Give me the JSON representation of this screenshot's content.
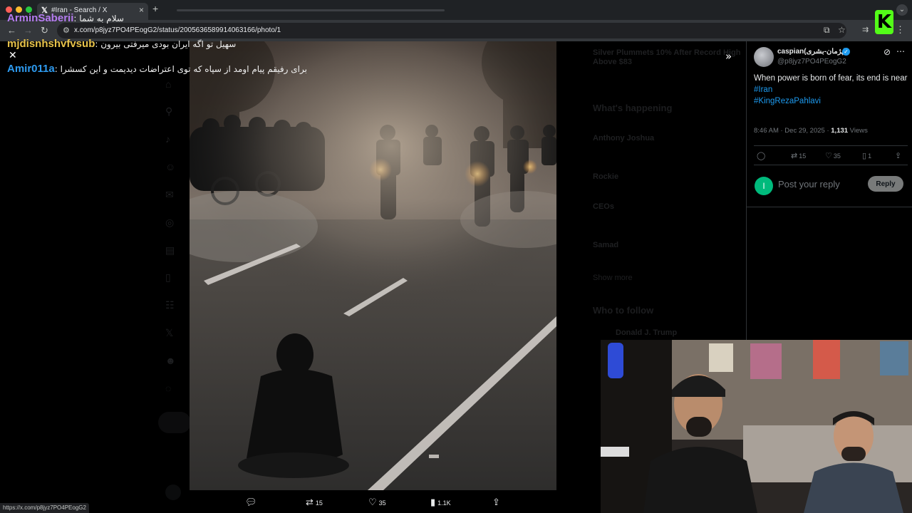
{
  "browser": {
    "tab_title": "#Iran - Search / X",
    "tab_close": "×",
    "new_tab": "+",
    "tab_menu": "⌄",
    "url": "x.com/p8jyz7PO4PEogG2/status/2005636589914063166/photo/1",
    "status_url": "https://x.com/p8jyz7PO4PEogG2",
    "icons": [
      "back-icon",
      "forward-icon",
      "reload-icon",
      "site-info-icon",
      "cast-icon",
      "bookmark-star-icon",
      "extensions-icon",
      "kick-extension-icon",
      "menu-icon"
    ],
    "kick_logo": "K"
  },
  "chat": [
    {
      "user": "ArminSaberii",
      "message": "سلام به شما",
      "color": "#b57cf0"
    },
    {
      "user": "mjdisnhshvfvsub",
      "message": "سهیل تو اگه ایران بودی میرفتی بیرون",
      "color": "#e8c34a"
    },
    {
      "user": "Amir011a",
      "message": "برای رفیقم پیام اومد از سپاه که توی اعتراضات دیدیمت و این کسشرا",
      "color": "#2e9bf0"
    }
  ],
  "overlay": {
    "close_icon": "✕",
    "expand_icon": "»"
  },
  "photo_actions": {
    "reply_icon": "reply-icon",
    "retweets": "15",
    "likes": "35",
    "views": "1.1K",
    "share_icon": "share-icon"
  },
  "ghost_right": {
    "trend_1": "Silver Plummets 10% After Record High",
    "trend_1b": "Above $83",
    "whats_happening": "What's happening",
    "item_1": "Anthony Joshua",
    "item_2": "Rockie",
    "item_3": "CEOs",
    "item_4": "Samad",
    "show_more": "Show more",
    "who_to_follow": "Who to follow",
    "follow_1": "Donald J. Trump"
  },
  "tweet": {
    "author_name": "caspian(پژمان-بشری)",
    "author_handle": "@p8jyz7PO4PEogG2",
    "text": "When power is born of fear, its end is near",
    "hashtags": [
      "#Iran",
      "#KingRezaPahlavi"
    ],
    "time": "8:46 AM · Dec 29, 2025 · ",
    "views_count": "1,131",
    "views_label": " Views",
    "replies": "",
    "retweets": "15",
    "likes": "35",
    "bookmarks": "1",
    "reply_avatar_letter": "I",
    "reply_placeholder": "Post your reply",
    "reply_button": "Reply"
  },
  "colors": {
    "accent": "#1d9bf0",
    "verified": "#1d9bf0",
    "kick_green": "#53fc18"
  }
}
